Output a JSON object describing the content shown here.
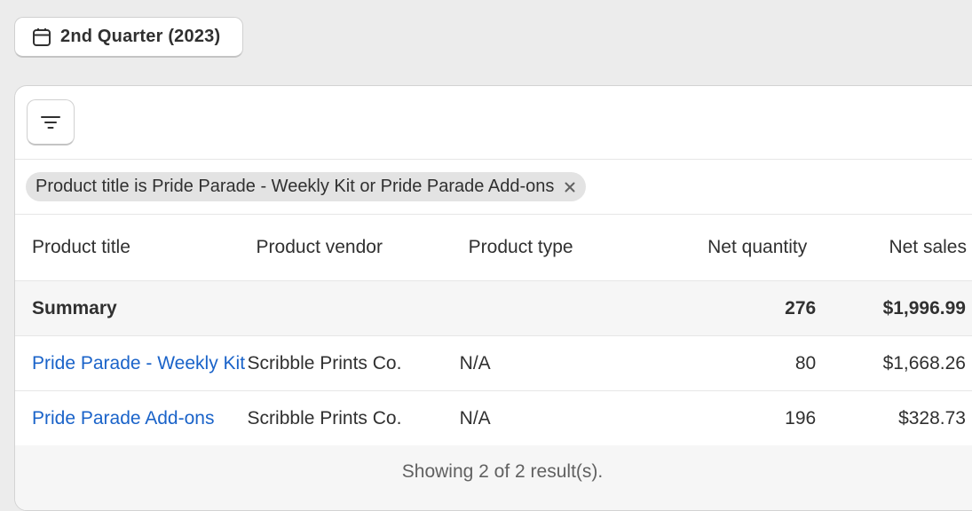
{
  "date_range": {
    "icon": "calendar-icon",
    "label": "2nd Quarter (2023)"
  },
  "toolbar": {
    "filter_icon": "filter-lines-icon"
  },
  "filter_chip": {
    "label": "Product title is Pride Parade - Weekly Kit or Pride Parade Add-ons",
    "remove_icon": "close-icon"
  },
  "table": {
    "columns": [
      "Product title",
      "Product vendor",
      "Product type",
      "Net quantity",
      "Net sales"
    ],
    "summary": {
      "label": "Summary",
      "net_quantity": "276",
      "net_sales": "$1,996.99"
    },
    "rows": [
      {
        "product_title": "Pride Parade - Weekly Kit",
        "product_vendor": "Scribble Prints Co.",
        "product_type": "N/A",
        "net_quantity": "80",
        "net_sales": "$1,668.26"
      },
      {
        "product_title": "Pride Parade Add-ons",
        "product_vendor": "Scribble Prints Co.",
        "product_type": "N/A",
        "net_quantity": "196",
        "net_sales": "$328.73"
      }
    ]
  },
  "footer": {
    "results_text": "Showing 2 of 2 result(s)."
  },
  "colors": {
    "link": "#1a63c9",
    "page_bg": "#ececec",
    "summary_bg": "#f6f6f6"
  }
}
